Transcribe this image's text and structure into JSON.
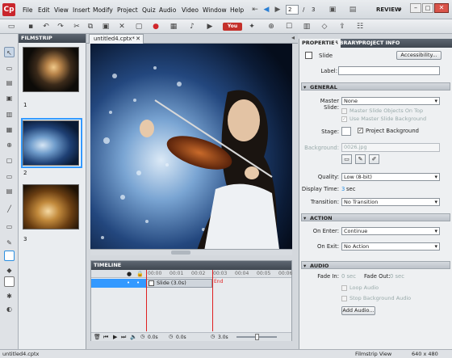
{
  "menu": {
    "items": [
      "File",
      "Edit",
      "View",
      "Insert",
      "Modify",
      "Project",
      "Quiz",
      "Audio",
      "Video",
      "Window",
      "Help"
    ]
  },
  "header": {
    "page_current": "2",
    "page_sep": "/",
    "page_total": "3",
    "workspace": "REVIEW"
  },
  "filmstrip": {
    "title": "FILMSTRIP",
    "slides": [
      {
        "num": "1"
      },
      {
        "num": "2"
      },
      {
        "num": "3"
      }
    ]
  },
  "document": {
    "tab": "untitled4.cptx*"
  },
  "timeline": {
    "title": "TIMELINE",
    "layer": "Slide (3.0s)",
    "end_label": "End",
    "time1": "0.0s",
    "time2": "0.0s",
    "time3": "3.0s",
    "ticks": [
      "00:00",
      "00:01",
      "00:02",
      "00:03",
      "00:04",
      "00:05",
      "00:06"
    ]
  },
  "properties": {
    "tabs": [
      "PROPERTIES",
      "LIBRARY",
      "PROJECT INFO"
    ],
    "slide_title": "Slide",
    "accessibility_button": "Accessibility...",
    "label_label": "Label:",
    "label_value": "",
    "general": {
      "title": "GENERAL",
      "master_slide_label": "Master Slide:",
      "master_slide_value": "None",
      "master_objects_on_top": "Master Slide Objects On Top",
      "use_master_bg": "Use Master Slide Background",
      "stage_label": "Stage:",
      "project_background": "Project Background",
      "background_label": "Background:",
      "background_value": "0026.jpg",
      "quality_label": "Quality:",
      "quality_value": "Low (8-bit)",
      "display_time_label": "Display Time:",
      "display_time_value": "3",
      "display_time_unit": "sec",
      "transition_label": "Transition:",
      "transition_value": "No Transition"
    },
    "action": {
      "title": "ACTION",
      "on_enter_label": "On Enter:",
      "on_enter_value": "Continue",
      "on_exit_label": "On Exit:",
      "on_exit_value": "No Action"
    },
    "audio": {
      "title": "AUDIO",
      "fade_in_label": "Fade In:",
      "fade_in_value": "0 sec",
      "fade_out_label": "Fade Out:",
      "fade_out_value": "0 sec",
      "loop_audio": "Loop Audio",
      "stop_bg_audio": "Stop Background Audio",
      "add_audio_button": "Add Audio..."
    }
  },
  "status": {
    "file": "untitled4.cptx",
    "view": "Filmstrip View",
    "size": "640 x 480"
  },
  "colors": {
    "accent": "#2b8fe0",
    "selection": "#3399ff"
  }
}
